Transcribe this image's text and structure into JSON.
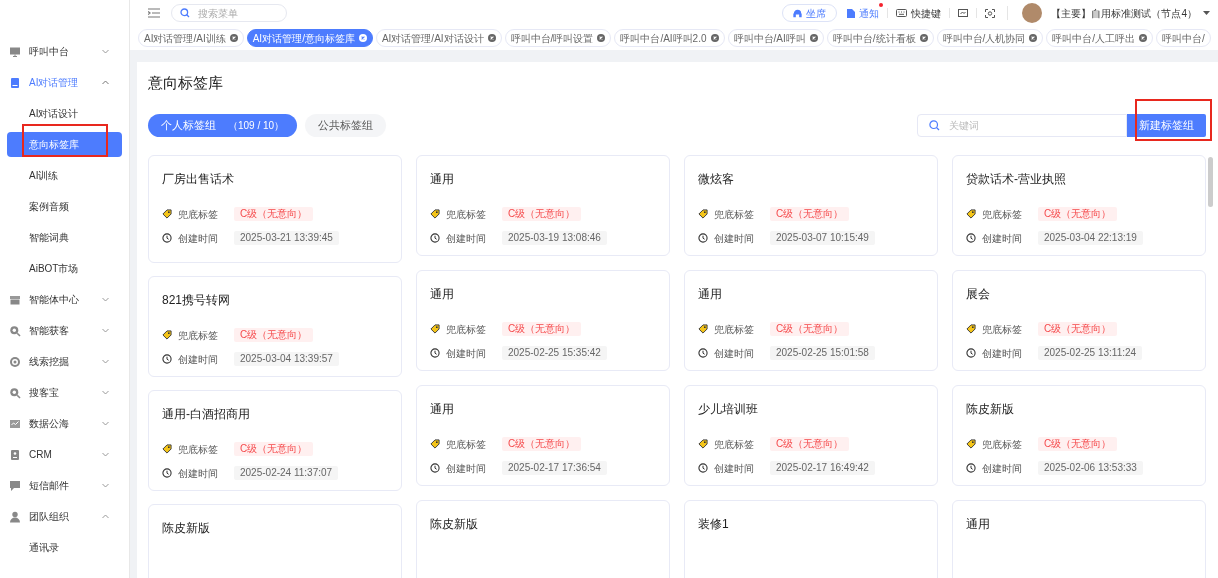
{
  "header": {
    "search_placeholder": "搜索菜单",
    "seat_button": "坐席",
    "notice_button": "通知",
    "notice_unread": true,
    "shortcut_button": "快捷键",
    "user_name": "【主要】自用标准测试（节点4）"
  },
  "tabs": [
    {
      "label": "AI对话管理/AI训练",
      "selected": false,
      "closable": true
    },
    {
      "label": "AI对话管理/意向标签库",
      "selected": true,
      "closable": true
    },
    {
      "label": "AI对话管理/AI对话设计",
      "selected": false,
      "closable": true
    },
    {
      "label": "呼叫中台/呼叫设置",
      "selected": false,
      "closable": true
    },
    {
      "label": "呼叫中台/AI呼叫2.0",
      "selected": false,
      "closable": true
    },
    {
      "label": "呼叫中台/AI呼叫",
      "selected": false,
      "closable": true
    },
    {
      "label": "呼叫中台/统计看板",
      "selected": false,
      "closable": true
    },
    {
      "label": "呼叫中台/人机协同",
      "selected": false,
      "closable": true
    },
    {
      "label": "呼叫中台/人工呼出",
      "selected": false,
      "closable": true
    },
    {
      "label": "呼叫中台/",
      "selected": false,
      "closable": false
    }
  ],
  "sidebar": {
    "items": [
      {
        "label": "呼叫中台",
        "expanded": false,
        "selected": false
      },
      {
        "label": "AI对话管理",
        "expanded": true,
        "selected": true,
        "children": [
          {
            "label": "AI对话设计",
            "selected": false,
            "highlighted": false
          },
          {
            "label": "意向标签库",
            "selected": true,
            "highlighted": true
          },
          {
            "label": "AI训练",
            "selected": false,
            "highlighted": false
          },
          {
            "label": "案例音频",
            "selected": false,
            "highlighted": false
          },
          {
            "label": "智能词典",
            "selected": false,
            "highlighted": false
          },
          {
            "label": "AiBOT市场",
            "selected": false,
            "highlighted": false
          }
        ]
      },
      {
        "label": "智能体中心",
        "expanded": false,
        "selected": false
      },
      {
        "label": "智能获客",
        "expanded": false,
        "selected": false
      },
      {
        "label": "线索挖掘",
        "expanded": false,
        "selected": false
      },
      {
        "label": "搜客宝",
        "expanded": false,
        "selected": false
      },
      {
        "label": "数据公海",
        "expanded": false,
        "selected": false
      },
      {
        "label": "CRM",
        "expanded": false,
        "selected": false
      },
      {
        "label": "短信邮件",
        "expanded": false,
        "selected": false
      },
      {
        "label": "团队组织",
        "expanded": true,
        "selected": false,
        "children": [
          {
            "label": "通讯录",
            "selected": false,
            "highlighted": false
          }
        ]
      }
    ]
  },
  "page": {
    "title": "意向标签库",
    "groups": [
      {
        "label": "个人标签组",
        "count": "（109 / 10）",
        "selected": true
      },
      {
        "label": "公共标签组",
        "selected": false
      }
    ],
    "search_placeholder": "关键词",
    "new_button": {
      "label": "新建标签组",
      "highlighted": true
    },
    "columns": [
      [
        {
          "title": "厂房出售话术",
          "tag_label": "兜底标签",
          "tag": "C级（无意向）",
          "time_label": "创建时间",
          "time": "2025-03-21 13:39:45"
        },
        {
          "title": "821携号转网",
          "tag_label": "兜底标签",
          "tag": "C级（无意向）",
          "time_label": "创建时间",
          "time": "2025-03-04 13:39:57"
        },
        {
          "title": "通用-白酒招商用",
          "tag_label": "兜底标签",
          "tag": "C级（无意向）",
          "time_label": "创建时间",
          "time": "2025-02-24 11:37:07"
        },
        {
          "title": "陈皮新版"
        }
      ],
      [
        {
          "title": "通用",
          "tag_label": "兜底标签",
          "tag": "C级（无意向）",
          "time_label": "创建时间",
          "time": "2025-03-19 13:08:46"
        },
        {
          "title": "通用",
          "tag_label": "兜底标签",
          "tag": "C级（无意向）",
          "time_label": "创建时间",
          "time": "2025-02-25 15:35:42"
        },
        {
          "title": "通用",
          "tag_label": "兜底标签",
          "tag": "C级（无意向）",
          "time_label": "创建时间",
          "time": "2025-02-17 17:36:54"
        },
        {
          "title": "陈皮新版"
        }
      ],
      [
        {
          "title": "微炫客",
          "tag_label": "兜底标签",
          "tag": "C级（无意向）",
          "time_label": "创建时间",
          "time": "2025-03-07 10:15:49"
        },
        {
          "title": "通用",
          "tag_label": "兜底标签",
          "tag": "C级（无意向）",
          "time_label": "创建时间",
          "time": "2025-02-25 15:01:58"
        },
        {
          "title": "少儿培训班",
          "tag_label": "兜底标签",
          "tag": "C级（无意向）",
          "time_label": "创建时间",
          "time": "2025-02-17 16:49:42"
        },
        {
          "title": "装修1"
        }
      ],
      [
        {
          "title": "贷款话术-营业执照",
          "tag_label": "兜底标签",
          "tag": "C级（无意向）",
          "time_label": "创建时间",
          "time": "2025-03-04 22:13:19"
        },
        {
          "title": "展会",
          "tag_label": "兜底标签",
          "tag": "C级（无意向）",
          "time_label": "创建时间",
          "time": "2025-02-25 13:11:24"
        },
        {
          "title": "陈皮新版",
          "tag_label": "兜底标签",
          "tag": "C级（无意向）",
          "time_label": "创建时间",
          "time": "2025-02-06 13:53:33"
        },
        {
          "title": "通用"
        }
      ]
    ]
  }
}
